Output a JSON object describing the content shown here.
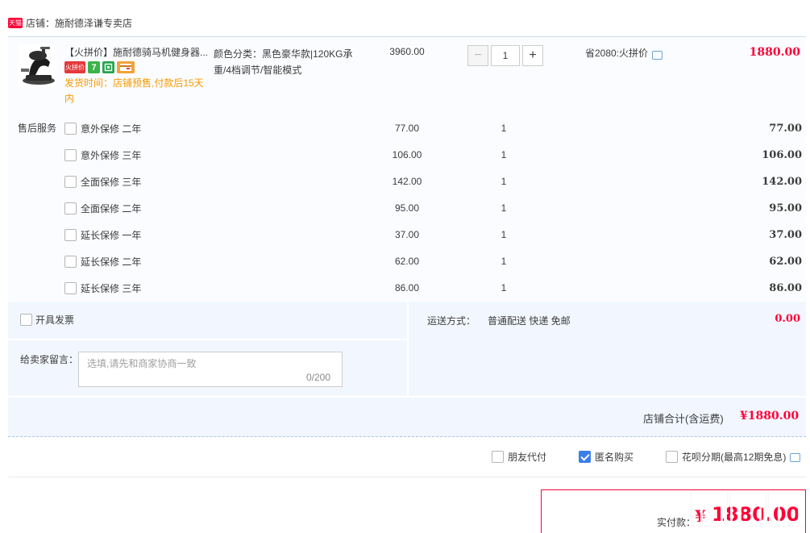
{
  "shop": {
    "badge": "天猫",
    "name": "店铺：施耐德泽谦专卖店"
  },
  "product": {
    "title": "【火拼价】施耐德骑马机健身器...",
    "badges": {
      "pin": "火拼价",
      "seven": "7"
    },
    "ship_time": "发货时间：店铺预售,付款后15天内",
    "sku": "颜色分类：黑色豪华款|120KG承重/4档调节/智能模式",
    "unit_price": "3960.00",
    "qty_minus": "−",
    "qty": "1",
    "qty_plus": "+",
    "save": "省2080:火拼价",
    "sum": "1880.00"
  },
  "service": {
    "title": "售后服务",
    "items": [
      {
        "name": "意外保修 二年",
        "price": "77.00",
        "qty": "1",
        "sum": "77.00"
      },
      {
        "name": "意外保修 三年",
        "price": "106.00",
        "qty": "1",
        "sum": "106.00"
      },
      {
        "name": "全面保修 三年",
        "price": "142.00",
        "qty": "1",
        "sum": "142.00"
      },
      {
        "name": "全面保修 二年",
        "price": "95.00",
        "qty": "1",
        "sum": "95.00"
      },
      {
        "name": "延长保修 一年",
        "price": "37.00",
        "qty": "1",
        "sum": "37.00"
      },
      {
        "name": "延长保修 二年",
        "price": "62.00",
        "qty": "1",
        "sum": "62.00"
      },
      {
        "name": "延长保修 三年",
        "price": "86.00",
        "qty": "1",
        "sum": "86.00"
      }
    ]
  },
  "options": {
    "invoice": "开具发票",
    "memo_label": "给卖家留言：",
    "memo_placeholder": "选填,请先和商家协商一致",
    "memo_count": "0/200",
    "ship_label": "运送方式：",
    "ship_value": "普通配送 快递 免邮",
    "ship_fee": "0.00"
  },
  "total": {
    "label": "店铺合计(含运费)",
    "value": "¥1880.00"
  },
  "checkout_opts": {
    "friend_pay": "朋友代付",
    "anonymous": "匿名购买",
    "huabei": "花呗分期(最高12期免息)"
  },
  "pay": {
    "label": "实付款：",
    "currency": "¥",
    "value": "1880.00"
  },
  "watermark": {
    "url": "zhidezhi.com"
  },
  "colors": {
    "price_red": "#ff0036",
    "ship_orange": "#f59a00",
    "accent_blue": "#3a7fe6",
    "tmall_red": "#ff0036"
  }
}
